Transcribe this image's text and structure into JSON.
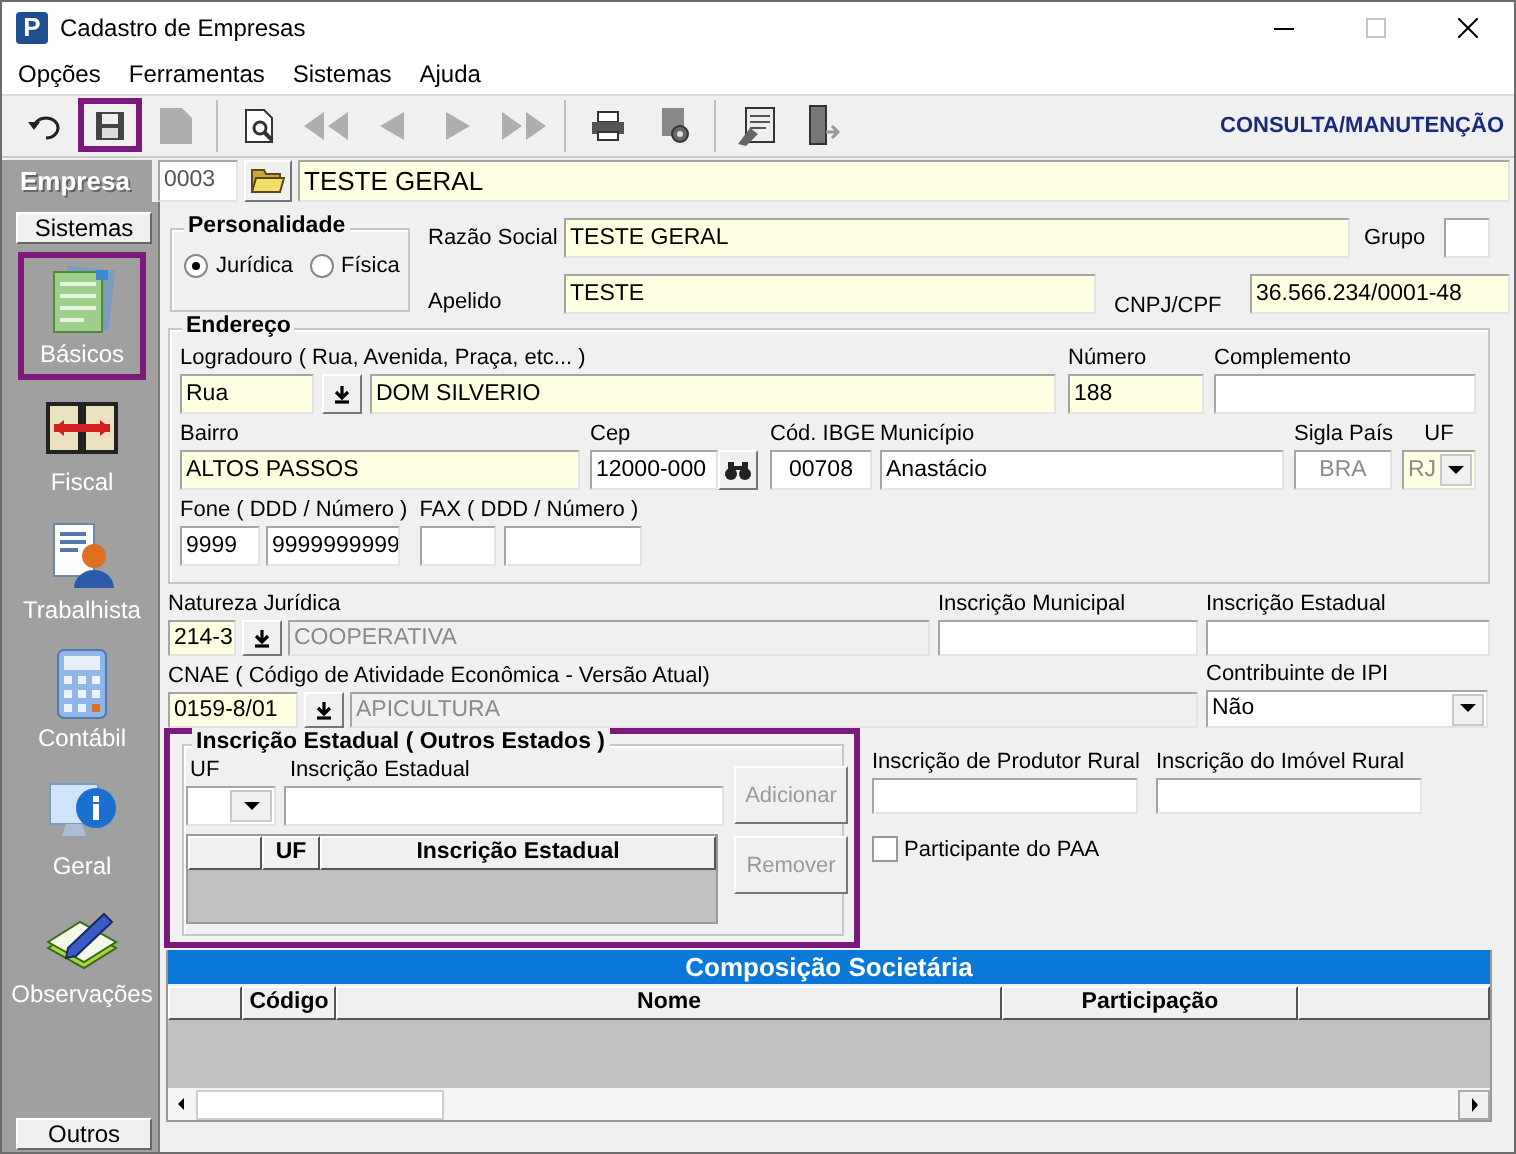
{
  "window": {
    "title": "Cadastro de Empresas",
    "icon_text": "P"
  },
  "menu": [
    "Opções",
    "Ferramentas",
    "Sistemas",
    "Ajuda"
  ],
  "toolbar": {
    "mode": "CONSULTA/MANUTENÇÃO",
    "tools": [
      {
        "kind": "undo",
        "disabled": false,
        "highlighted": false
      },
      {
        "kind": "save",
        "disabled": false,
        "highlighted": true
      },
      {
        "kind": "new",
        "disabled": true,
        "highlighted": false
      },
      {
        "kind": "separator"
      },
      {
        "kind": "preview",
        "disabled": false,
        "highlighted": false
      },
      {
        "kind": "first",
        "disabled": true,
        "highlighted": false
      },
      {
        "kind": "prev",
        "disabled": true,
        "highlighted": false
      },
      {
        "kind": "next",
        "disabled": true,
        "highlighted": false
      },
      {
        "kind": "last",
        "disabled": true,
        "highlighted": false
      },
      {
        "kind": "separator"
      },
      {
        "kind": "print",
        "disabled": false,
        "highlighted": false
      },
      {
        "kind": "config",
        "disabled": false,
        "highlighted": false
      },
      {
        "kind": "separator"
      },
      {
        "kind": "report",
        "disabled": false,
        "highlighted": false
      },
      {
        "kind": "exit",
        "disabled": false,
        "highlighted": false
      }
    ]
  },
  "empresa": {
    "label": "Empresa",
    "code": "0003",
    "name": "TESTE GERAL",
    "required": true
  },
  "sidebar": {
    "header": "Sistemas",
    "footer": "Outros",
    "items": [
      {
        "label": "Básicos",
        "kind": "form",
        "highlighted": true
      },
      {
        "label": "Fiscal",
        "kind": "book",
        "highlighted": false
      },
      {
        "label": "Trabalhista",
        "kind": "person",
        "highlighted": false
      },
      {
        "label": "Contábil",
        "kind": "calculator",
        "highlighted": false
      },
      {
        "label": "Geral",
        "kind": "computer",
        "highlighted": false
      },
      {
        "label": "Observações",
        "kind": "notepad",
        "highlighted": false
      }
    ]
  },
  "personalidade": {
    "title": "Personalidade",
    "options": [
      {
        "label": "Jurídica",
        "selected": true
      },
      {
        "label": "Física",
        "selected": false
      }
    ]
  },
  "identity": {
    "razao_social": {
      "label": "Razão Social",
      "value": "TESTE GERAL",
      "required": true
    },
    "grupo": {
      "label": "Grupo",
      "required": false
    },
    "apelido": {
      "label": "Apelido",
      "value": "TESTE",
      "required": true
    },
    "cnpj_cpf": {
      "label": "CNPJ/CPF",
      "value": "36.566.234/0001-48",
      "required": true
    }
  },
  "endereco": {
    "title": "Endereço",
    "logradouro": {
      "label": "Logradouro ( Rua, Avenida, Praça, etc... )",
      "type": "Rua",
      "value": "DOM SILVERIO",
      "required": true
    },
    "numero": {
      "label": "Número",
      "value": "188",
      "required": true
    },
    "complemento": {
      "label": "Complemento",
      "required": false
    },
    "bairro": {
      "label": "Bairro",
      "value": "ALTOS PASSOS",
      "required": true
    },
    "cep": {
      "label": "Cep",
      "value": "12000-000",
      "required": false
    },
    "ibge": {
      "label": "Cód. IBGE",
      "value": "00708",
      "required": false
    },
    "municipio": {
      "label": "Município",
      "value": "Anastácio",
      "required": false
    },
    "sigla_pais": {
      "label": "Sigla País",
      "value": "BRA",
      "required": false,
      "disabled": true
    },
    "uf": {
      "label": "UF",
      "value": "RJ",
      "required": true,
      "disabled": true
    },
    "fone": {
      "label": "Fone ( DDD / Número )",
      "ddd": "9999",
      "numero": "9999999999",
      "required": false
    },
    "fax": {
      "label": "FAX ( DDD / Número )",
      "required": false
    }
  },
  "natureza": {
    "label": "Natureza Jurídica",
    "code": "214-3",
    "description": "COOPERATIVA",
    "required": true
  },
  "inscricao_municipal": {
    "label": "Inscrição Municipal",
    "required": false
  },
  "inscricao_estadual": {
    "label": "Inscrição Estadual",
    "required": false
  },
  "cnae": {
    "label": "CNAE ( Código de Atividade Econômica - Versão Atual)",
    "code": "0159-8/01",
    "description": "APICULTURA",
    "required": true
  },
  "contribuinte_ipi": {
    "label": "Contribuinte de IPI",
    "value": "Não"
  },
  "ie_outros": {
    "title": "Inscrição Estadual ( Outros Estados )",
    "highlighted": true,
    "uf_label": "UF",
    "ie_label": "Inscrição Estadual",
    "buttons": [
      {
        "label": "Adicionar",
        "disabled": true
      },
      {
        "label": "Remover",
        "disabled": true
      }
    ],
    "columns": [
      "UF",
      "Inscrição Estadual"
    ]
  },
  "produtor_rural": {
    "label": "Inscrição de Produtor Rural"
  },
  "imovel_rural": {
    "label": "Inscrição do Imóvel Rural"
  },
  "paa": {
    "label": "Participante do PAA",
    "checked": false
  },
  "socios": {
    "title": "Composição Societária",
    "columns": [
      "Código",
      "Nome",
      "Participação"
    ]
  }
}
